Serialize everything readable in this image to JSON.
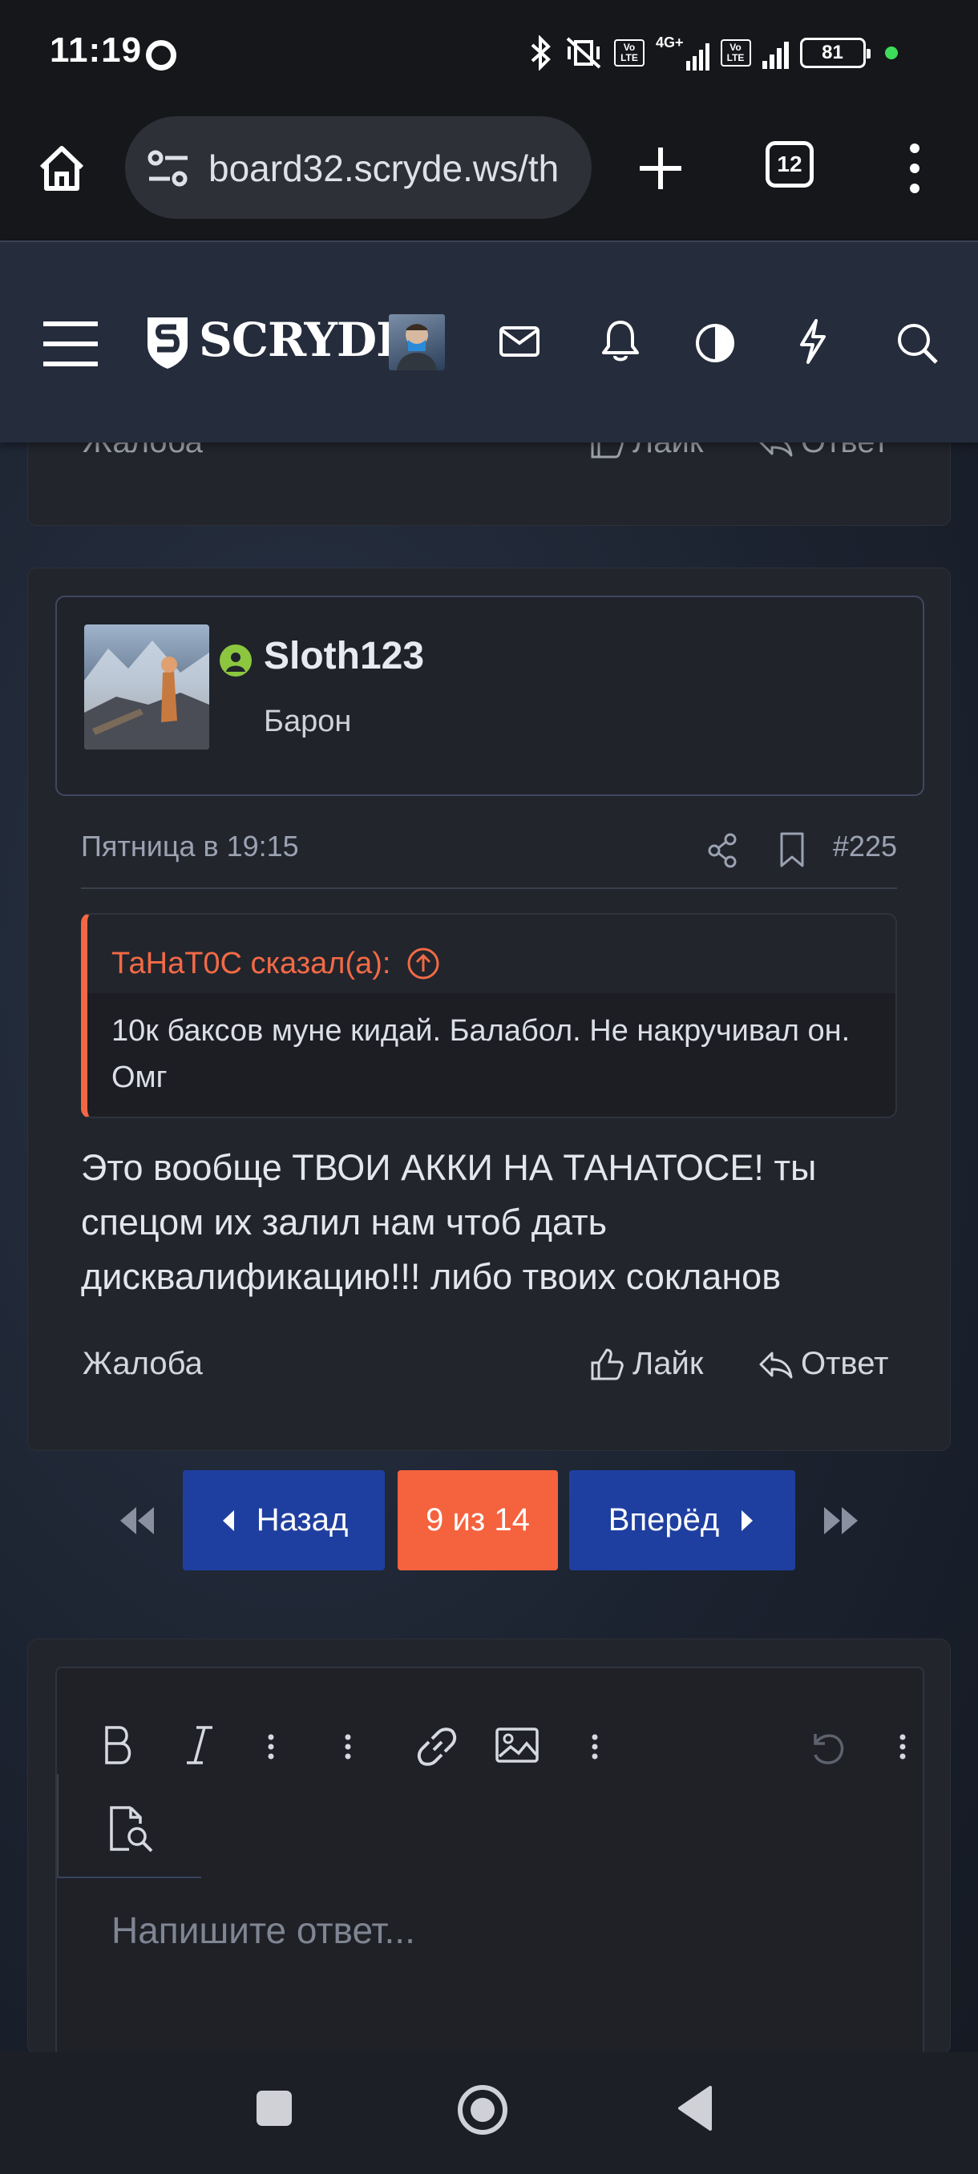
{
  "status_bar": {
    "time": "11:19",
    "network": "4G+",
    "volte_1": "Vo LTE",
    "volte_2": "Vo LTE",
    "battery": "81"
  },
  "browser": {
    "url": "board32.scryde.ws/th",
    "tab_count": "12"
  },
  "site_header": {
    "logo": "SCRYDE",
    "icons": [
      "menu-icon",
      "mail-icon",
      "bell-icon",
      "contrast-icon",
      "lightning-icon",
      "search-icon"
    ]
  },
  "previous_post": {
    "report": "Жалоба",
    "like": "Лайк",
    "reply": "Ответ"
  },
  "post": {
    "username": "Sloth123",
    "user_title": "Барон",
    "date": "Пятница в 19:15",
    "number": "#225",
    "quote_author": "ТаНаТ0С сказал(а):",
    "quote_text": "10к баксов муне кидай. Балабол. Не накручивал он. Омг",
    "text": "Это вообще ТВОИ АККИ НА ТАНАТОСЕ! ты спецом их залил нам чтоб дать дисквалификацию!!! либо твоих сокланов",
    "report": "Жалоба",
    "like": "Лайк",
    "reply": "Ответ"
  },
  "pagination": {
    "prev": "Назад",
    "current": "9 из 14",
    "next": "Вперёд"
  },
  "editor": {
    "placeholder": "Напишите ответ..."
  },
  "colors": {
    "accent": "#f26744",
    "primary_button": "#1f3fa0",
    "online": "#8cc63f"
  }
}
